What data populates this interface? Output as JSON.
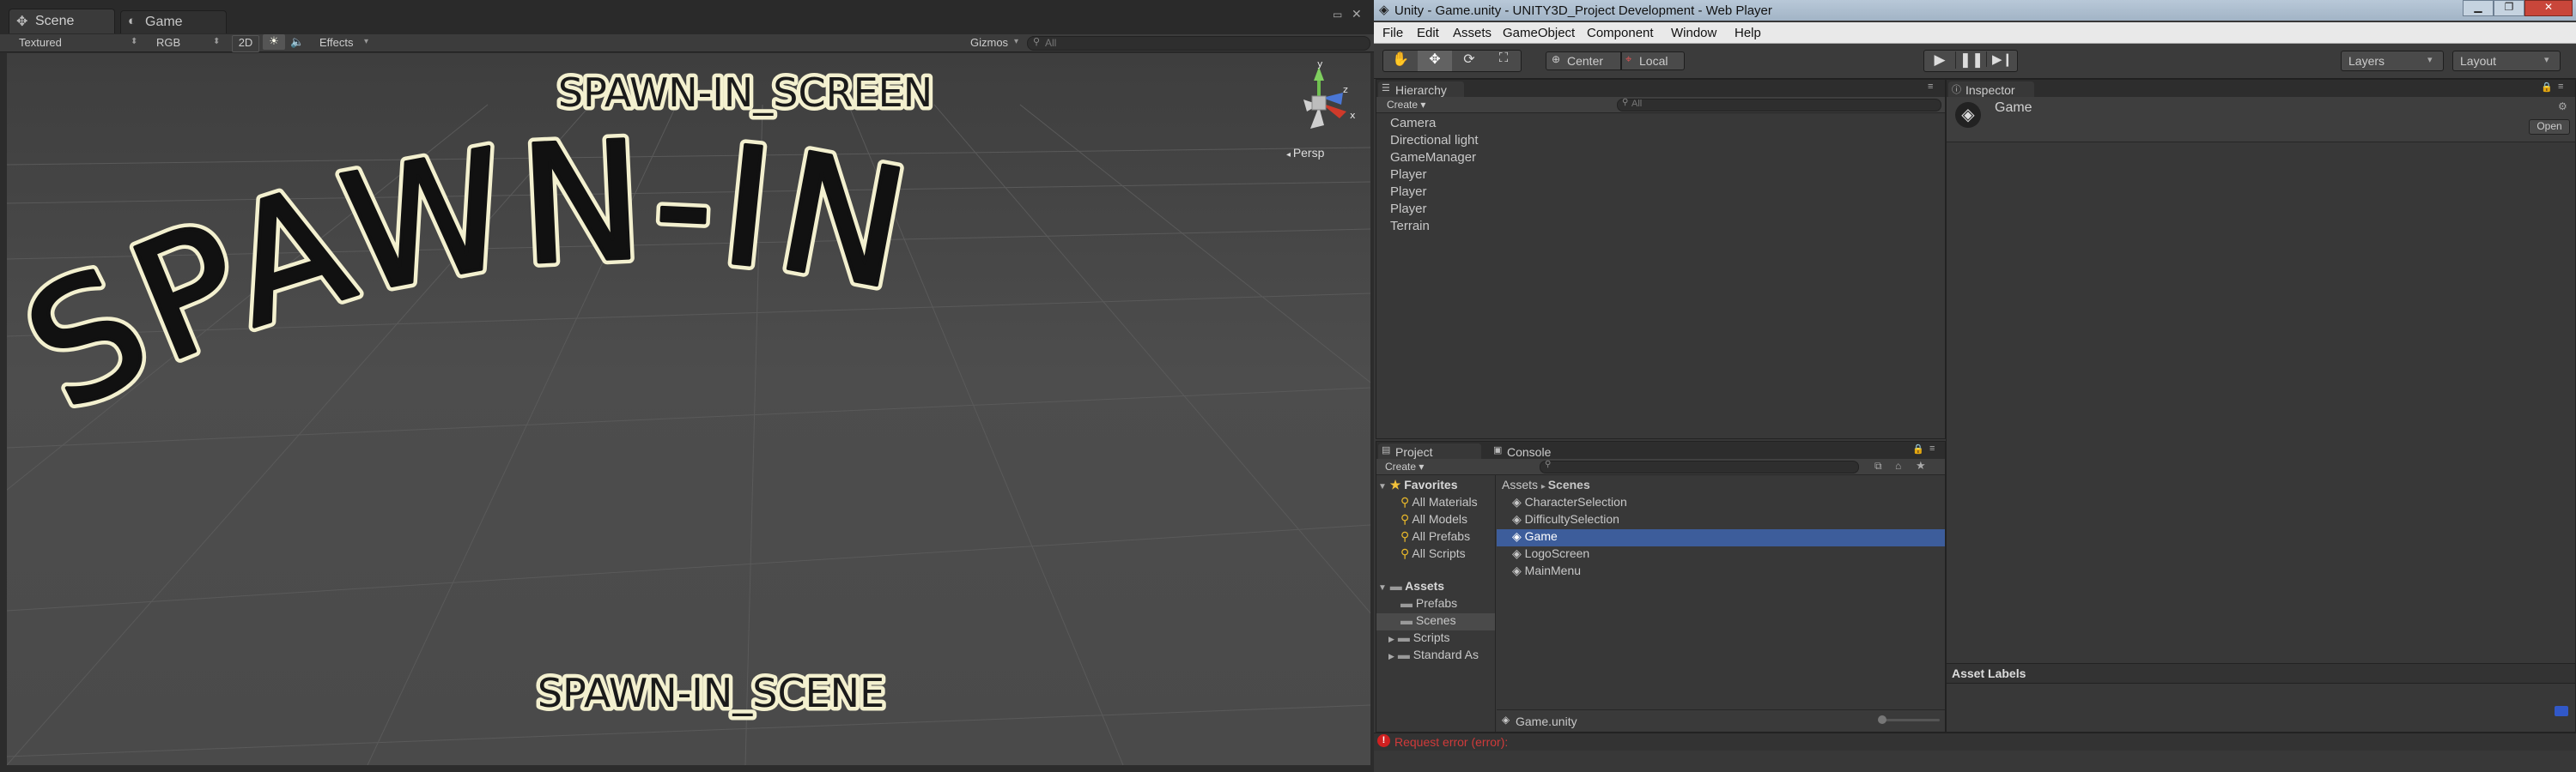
{
  "left_window": {
    "tabs": [
      {
        "label": "Scene",
        "icon": "scene-icon"
      },
      {
        "label": "Game",
        "icon": "game-icon"
      }
    ],
    "toolbar": {
      "shading": "Textured",
      "render_mode": "RGB",
      "mode_2d": "2D",
      "effects": "Effects",
      "gizmos": "Gizmos",
      "search_placeholder": "All"
    },
    "scene": {
      "spawn_in_text": "SPAWN-IN",
      "screen_label": "SPAWN-IN_SCREEN",
      "scene_label": "SPAWN-IN_SCENE",
      "persp_label": "Persp",
      "gizmo_axes": {
        "y": "y",
        "z": "z",
        "x": "x"
      }
    }
  },
  "right_window": {
    "title": "Unity - Game.unity - UNITY3D_Project Development - Web Player",
    "menu": [
      "File",
      "Edit",
      "Assets",
      "GameObject",
      "Component",
      "Window",
      "Help"
    ],
    "toolbar": {
      "pivot": "Center",
      "space": "Local",
      "layers": "Layers",
      "layout": "Layout"
    },
    "hierarchy": {
      "tab": "Hierarchy",
      "create": "Create",
      "search_placeholder": "All",
      "items": [
        "Camera",
        "Directional light",
        "GameManager",
        "Player",
        "Player",
        "Player",
        "Terrain"
      ]
    },
    "inspector": {
      "tab": "Inspector",
      "object_name": "Game",
      "open_button": "Open",
      "asset_labels": "Asset Labels"
    },
    "project": {
      "tab": "Project",
      "console_tab": "Console",
      "create": "Create",
      "favorites_label": "Favorites",
      "favorites": [
        "All Materials",
        "All Models",
        "All Prefabs",
        "All Scripts"
      ],
      "assets_label": "Assets",
      "asset_folders": [
        "Prefabs",
        "Scenes",
        "Scripts",
        "Standard As"
      ],
      "breadcrumb": [
        "Assets",
        "Scenes"
      ],
      "scenes": [
        "CharacterSelection",
        "DifficultySelection",
        "Game",
        "LogoScreen",
        "MainMenu"
      ],
      "selected_scene": "Game",
      "footer_file": "Game.unity"
    },
    "status": {
      "message": "Request error (error):",
      "error_color": "#d02020"
    }
  },
  "colors": {
    "selection": "#3d5d9b",
    "panel": "#383838",
    "scene_bg": "#4a4a4a"
  }
}
